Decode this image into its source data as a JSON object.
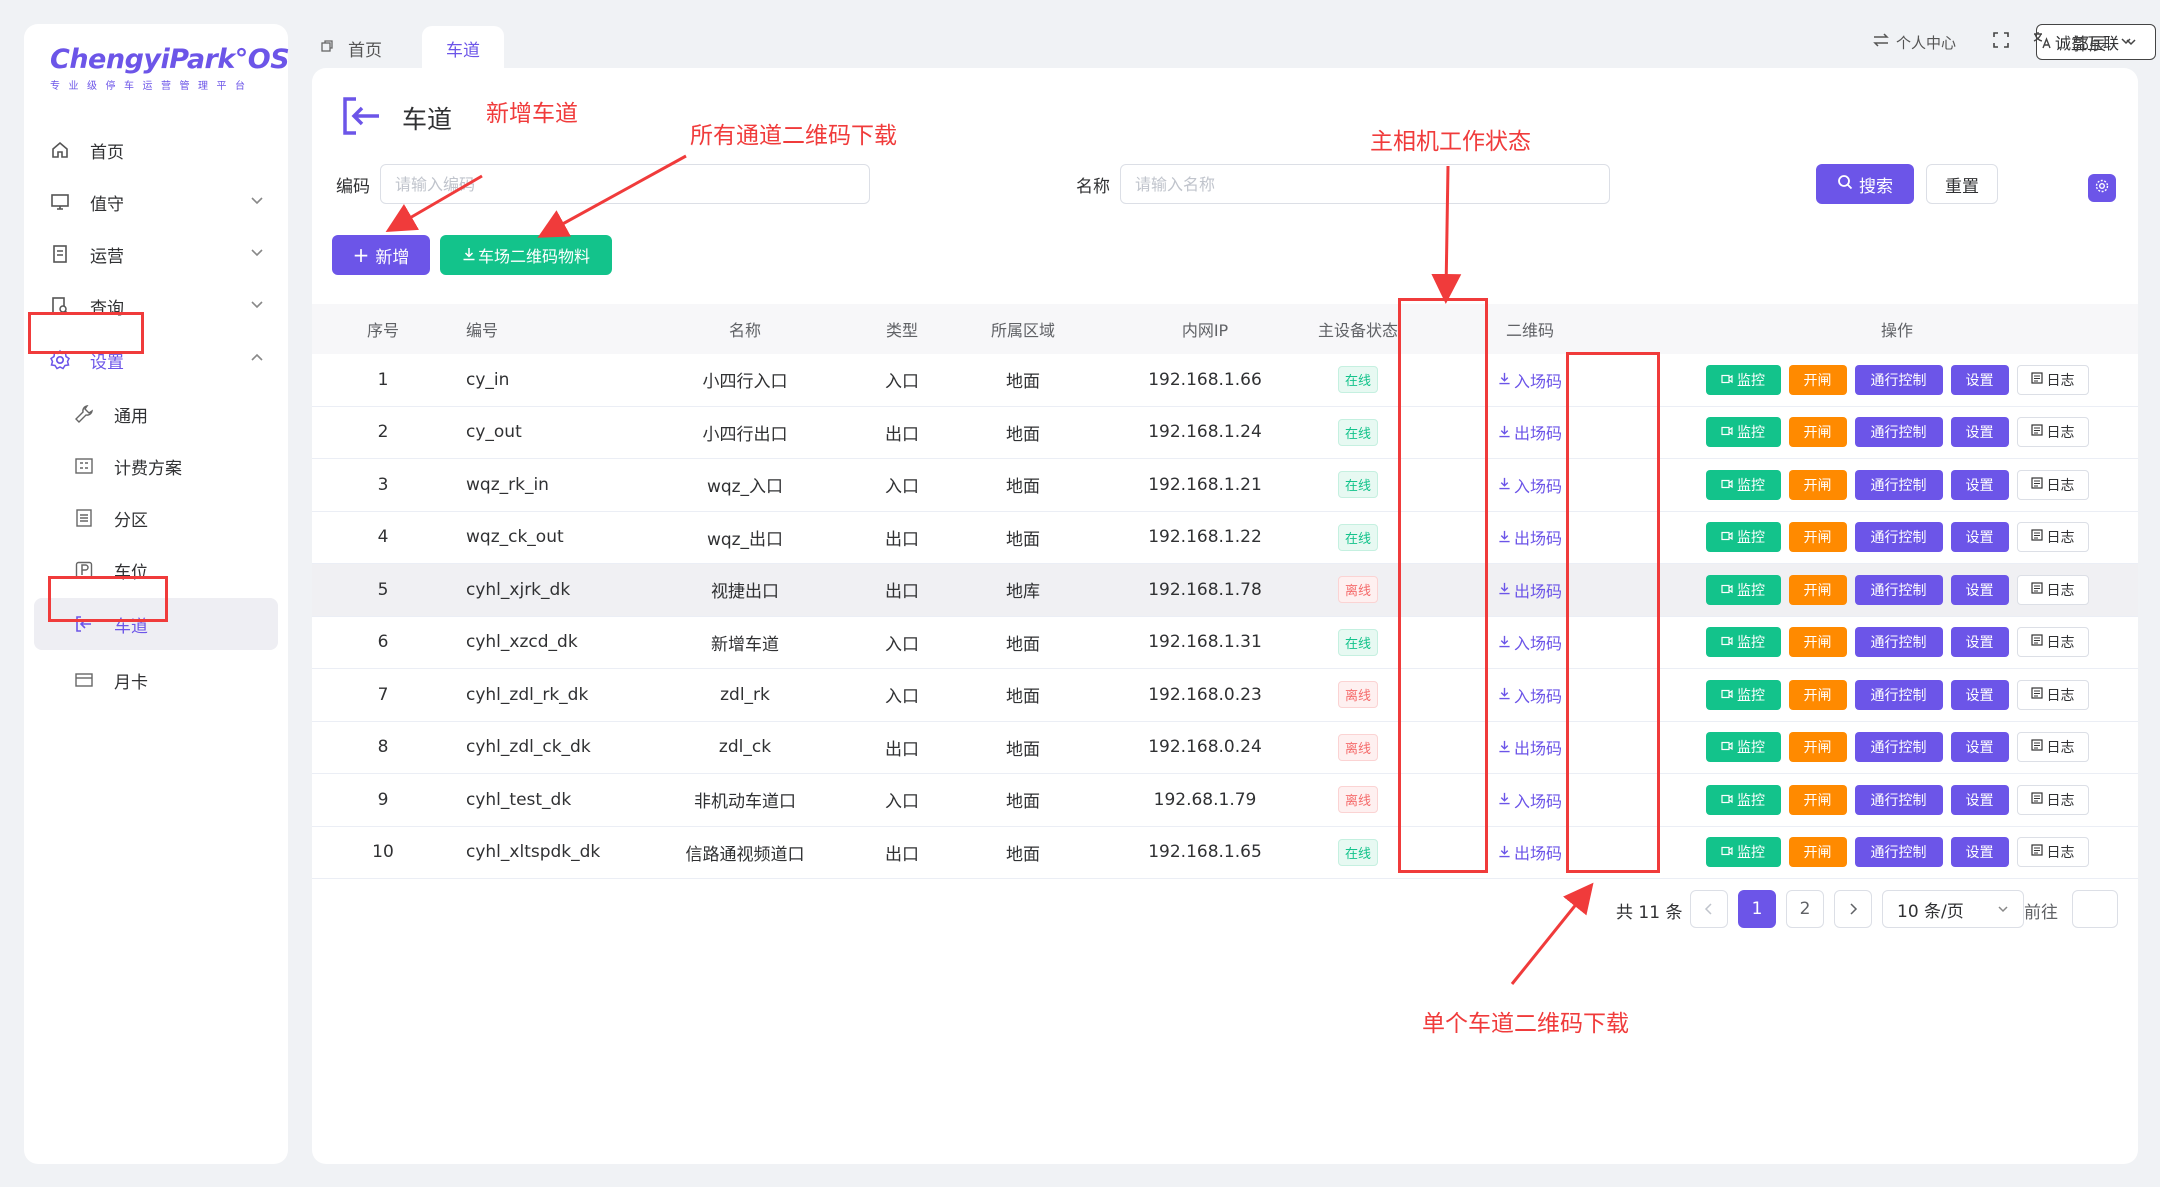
{
  "logo": {
    "main": "ChengyiPark°OS",
    "sub": "专业级停车运营管理平台"
  },
  "sidebar": {
    "items": [
      {
        "label": "首页",
        "icon": "home-icon"
      },
      {
        "label": "值守",
        "icon": "monitor-icon"
      },
      {
        "label": "运营",
        "icon": "document-icon"
      },
      {
        "label": "查询",
        "icon": "search-doc-icon"
      },
      {
        "label": "设置",
        "icon": "gear-icon"
      }
    ],
    "sub_items": [
      {
        "label": "通用",
        "icon": "wrench-icon"
      },
      {
        "label": "计费方案",
        "icon": "grid-icon"
      },
      {
        "label": "分区",
        "icon": "partition-icon"
      },
      {
        "label": "车位",
        "icon": "parking-icon"
      },
      {
        "label": "车道",
        "icon": "lane-icon"
      },
      {
        "label": "月卡",
        "icon": "card-icon"
      }
    ]
  },
  "tabs": {
    "home": "首页",
    "active": "车道"
  },
  "header": {
    "company": "诚益互联",
    "personal_center": "个人中心",
    "lang_icon": "translate-icon",
    "user": "郭辰"
  },
  "page": {
    "title": "车道"
  },
  "filters": {
    "code_label": "编码",
    "code_placeholder": "请输入编码",
    "name_label": "名称",
    "name_placeholder": "请输入名称",
    "search_label": "搜索",
    "reset_label": "重置"
  },
  "actions": {
    "add_label": "新增",
    "qr_material_label": "车场二维码物料"
  },
  "table": {
    "headers": [
      "序号",
      "编号",
      "名称",
      "类型",
      "所属区域",
      "内网IP",
      "主设备状态",
      "二维码",
      "操作"
    ],
    "rows": [
      {
        "idx": "1",
        "code": "cy_in",
        "name": "小四行入口",
        "type": "入口",
        "area": "地面",
        "ip": "192.168.1.66",
        "status": "在线",
        "online": true,
        "qr": "入场码"
      },
      {
        "idx": "2",
        "code": "cy_out",
        "name": "小四行出口",
        "type": "出口",
        "area": "地面",
        "ip": "192.168.1.24",
        "status": "在线",
        "online": true,
        "qr": "出场码"
      },
      {
        "idx": "3",
        "code": "wqz_rk_in",
        "name": "wqz_入口",
        "type": "入口",
        "area": "地面",
        "ip": "192.168.1.21",
        "status": "在线",
        "online": true,
        "qr": "入场码"
      },
      {
        "idx": "4",
        "code": "wqz_ck_out",
        "name": "wqz_出口",
        "type": "出口",
        "area": "地面",
        "ip": "192.168.1.22",
        "status": "在线",
        "online": true,
        "qr": "出场码"
      },
      {
        "idx": "5",
        "code": "cyhl_xjrk_dk",
        "name": "视捷出口",
        "type": "出口",
        "area": "地库",
        "ip": "192.168.1.78",
        "status": "离线",
        "online": false,
        "qr": "出场码"
      },
      {
        "idx": "6",
        "code": "cyhl_xzcd_dk",
        "name": "新增车道",
        "type": "入口",
        "area": "地面",
        "ip": "192.168.1.31",
        "status": "在线",
        "online": true,
        "qr": "入场码"
      },
      {
        "idx": "7",
        "code": "cyhl_zdl_rk_dk",
        "name": "zdl_rk",
        "type": "入口",
        "area": "地面",
        "ip": "192.168.0.23",
        "status": "离线",
        "online": false,
        "qr": "入场码"
      },
      {
        "idx": "8",
        "code": "cyhl_zdl_ck_dk",
        "name": "zdl_ck",
        "type": "出口",
        "area": "地面",
        "ip": "192.168.0.24",
        "status": "离线",
        "online": false,
        "qr": "出场码"
      },
      {
        "idx": "9",
        "code": "cyhl_test_dk",
        "name": "非机动车道口",
        "type": "入口",
        "area": "地面",
        "ip": "192.68.1.79",
        "status": "离线",
        "online": false,
        "qr": "入场码"
      },
      {
        "idx": "10",
        "code": "cyhl_xltspdk_dk",
        "name": "信路通视频道口",
        "type": "出口",
        "area": "地面",
        "ip": "192.168.1.65",
        "status": "在线",
        "online": true,
        "qr": "出场码"
      }
    ],
    "ops": {
      "monitor": "监控",
      "open": "开闸",
      "control": "通行控制",
      "settings": "设置",
      "log": "日志"
    }
  },
  "pagination": {
    "total": "共 11 条",
    "pages": [
      "1",
      "2"
    ],
    "current": "1",
    "page_size": "10 条/页",
    "goto_label": "前往"
  },
  "annotations": {
    "add_lane": "新增车道",
    "all_qr": "所有通道二维码下载",
    "camera_status": "主相机工作状态",
    "single_qr": "单个车道二维码下载"
  },
  "colors": {
    "primary": "#6c55e8",
    "green": "#13c38b",
    "orange": "#ff8a00",
    "annotation": "#f03b3b"
  }
}
